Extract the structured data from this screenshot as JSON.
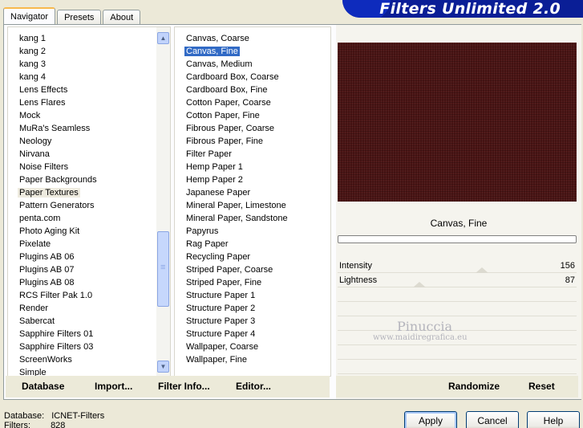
{
  "app": {
    "title": "Filters Unlimited 2.0"
  },
  "tabs": [
    {
      "label": "Navigator",
      "active": true
    },
    {
      "label": "Presets",
      "active": false
    },
    {
      "label": "About",
      "active": false
    }
  ],
  "categories": {
    "items": [
      "kang 1",
      "kang 2",
      "kang 3",
      "kang 4",
      "Lens Effects",
      "Lens Flares",
      "Mock",
      "MuRa's Seamless",
      "Neology",
      "Nirvana",
      "Noise Filters",
      "Paper Backgrounds",
      "Paper Textures",
      "Pattern Generators",
      "penta.com",
      "Photo Aging Kit",
      "Pixelate",
      "Plugins AB 06",
      "Plugins AB 07",
      "Plugins AB 08",
      "RCS Filter Pak 1.0",
      "Render",
      "Sabercat",
      "Sapphire Filters 01",
      "Sapphire Filters 03",
      "ScreenWorks",
      "Simple"
    ],
    "current": "Paper Textures"
  },
  "filters": {
    "items": [
      "Canvas, Coarse",
      "Canvas, Fine",
      "Canvas, Medium",
      "Cardboard Box, Coarse",
      "Cardboard Box, Fine",
      "Cotton Paper, Coarse",
      "Cotton Paper, Fine",
      "Fibrous Paper, Coarse",
      "Fibrous Paper, Fine",
      "Filter Paper",
      "Hemp Paper 1",
      "Hemp Paper 2",
      "Japanese Paper",
      "Mineral Paper, Limestone",
      "Mineral Paper, Sandstone",
      "Papyrus",
      "Rag Paper",
      "Recycling Paper",
      "Striped Paper, Coarse",
      "Striped Paper, Fine",
      "Structure Paper 1",
      "Structure Paper 2",
      "Structure Paper 3",
      "Structure Paper 4",
      "Wallpaper, Coarse",
      "Wallpaper, Fine"
    ],
    "selected": "Canvas, Fine"
  },
  "preview": {
    "filter_name": "Canvas, Fine",
    "sliders": [
      {
        "label": "Intensity",
        "value": "156"
      },
      {
        "label": "Lightness",
        "value": "87"
      }
    ],
    "watermark": "Pinuccia",
    "watermark_url": "www.maidiregrafica.eu"
  },
  "left_actions": {
    "database": "Database",
    "import": "Import...",
    "filter_info": "Filter Info...",
    "editor": "Editor..."
  },
  "right_actions": {
    "randomize": "Randomize",
    "reset": "Reset"
  },
  "status": {
    "database_label": "Database:",
    "database_value": "ICNET-Filters",
    "filters_label": "Filters:",
    "filters_value": "828"
  },
  "buttons": {
    "apply": "Apply",
    "cancel": "Cancel",
    "help": "Help"
  }
}
